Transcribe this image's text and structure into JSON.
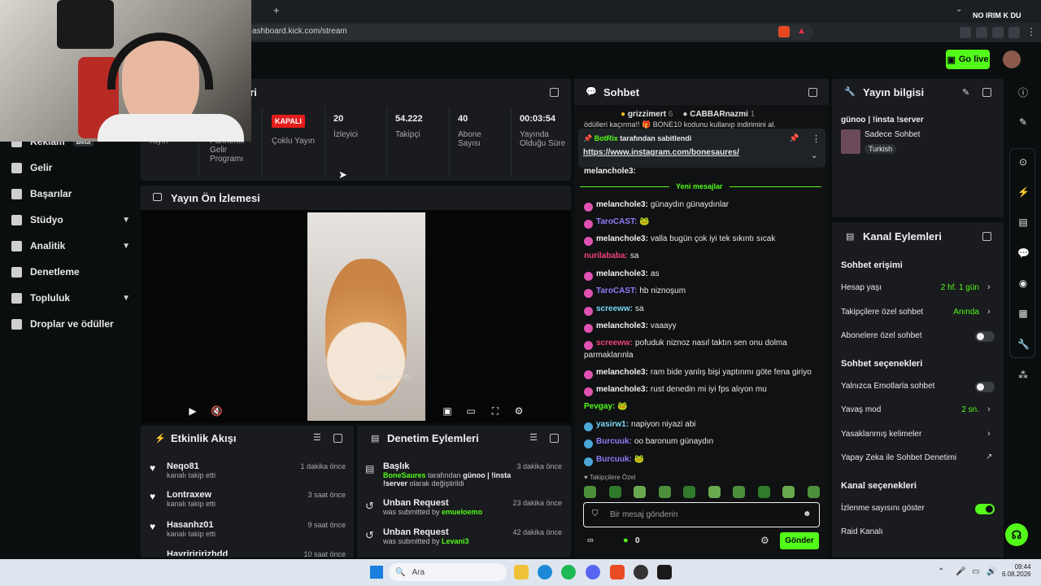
{
  "browser": {
    "url": "ashboard.kick.com/stream",
    "new_tab": "+",
    "profile_text": "NO IRIM K DU"
  },
  "topbar": {
    "go_live": "Go live"
  },
  "sidebar": {
    "items": [
      {
        "label": "Reklam",
        "badge": "Beta"
      },
      {
        "label": "Gelir"
      },
      {
        "label": "Başarılar"
      },
      {
        "label": "Stüdyo",
        "chevron": true
      },
      {
        "label": "Analitik",
        "chevron": true
      },
      {
        "label": "Denetleme"
      },
      {
        "label": "Topluluk",
        "chevron": true
      },
      {
        "label": "Droplar ve ödüller"
      }
    ]
  },
  "stats_panel": {
    "title_fragment": "eri",
    "cells": [
      {
        "value": "",
        "label": "Yayın"
      },
      {
        "value": "",
        "label": "Partnerlik Gelir Programı"
      },
      {
        "value": "KAPALI",
        "label": "Çoklu Yayın"
      },
      {
        "value": "20",
        "label": "İzleyici"
      },
      {
        "value": "54.222",
        "label": "Takipçi"
      },
      {
        "value": "40",
        "label": "Abone Sayısı"
      },
      {
        "value": "00:03:54",
        "label": "Yayında Olduğu Süre"
      }
    ]
  },
  "preview": {
    "title": "Yayın Ön İzlemesi",
    "watermark": "@yourmunch"
  },
  "activity": {
    "title": "Etkinlik Akışı",
    "items": [
      {
        "name": "Neqo81",
        "desc": "kanalı takip etti",
        "time": "1 dakika önce"
      },
      {
        "name": "Lontraxew",
        "desc": "kanalı takip etti",
        "time": "3 saat önce"
      },
      {
        "name": "Hasanhz01",
        "desc": "kanalı takip etti",
        "time": "9 saat önce"
      },
      {
        "name": "Hayririririzhdd",
        "desc": "",
        "time": "10 saat önce"
      }
    ]
  },
  "moderation": {
    "title": "Denetim Eylemleri",
    "items": [
      {
        "title": "Başlık",
        "user": "BoneSaures",
        "mid": "tarafından",
        "subject": "günoo | !insta !server",
        "tail": "olarak değiştirildi",
        "time": "3 dakika önce"
      },
      {
        "title": "Unban Request",
        "prefix": "was submitted by",
        "user": "emueloemo",
        "time": "23 dakika önce"
      },
      {
        "title": "Unban Request",
        "prefix": "was submitted by",
        "user": "Levani3",
        "time": "42 dakika önce"
      }
    ]
  },
  "chat": {
    "title": "Sohbet",
    "gifters": [
      {
        "name": "grizzimert",
        "count": "6"
      },
      {
        "name": "CABBARnazmi",
        "count": "1"
      }
    ],
    "cut_top": "ödülleri kaçırma!! 🎁 BONE10 kodunu kullanıp indirimini al.",
    "pinned": {
      "user": "BotRix",
      "text": "tarafından sabitlendi",
      "link": "https://www.instagram.com/bonesaures/"
    },
    "cut_user": "melanchole3:",
    "new_messages": "Yeni mesajlar",
    "messages": [
      {
        "badge": "26",
        "user": "melanchole3:",
        "color": "#f0f0f0",
        "text": "günaydın günaydınlar"
      },
      {
        "badge": "27",
        "user": "TaroCAST:",
        "color": "#8f7cf7",
        "text": "🐸"
      },
      {
        "badge": "26",
        "user": "melanchole3:",
        "color": "#f0f0f0",
        "text": "valla bugün çok iyi tek sıkıntı sıcak"
      },
      {
        "badge": "",
        "user": "nurilababa:",
        "color": "#f2427a",
        "text": "sa"
      },
      {
        "badge": "26",
        "user": "melanchole3:",
        "color": "#f0f0f0",
        "text": "as"
      },
      {
        "badge": "27",
        "user": "TaroCAST:",
        "color": "#8f7cf7",
        "text": "hb niznoşum"
      },
      {
        "badge": "27",
        "user": "screeww:",
        "color": "#7ad8f5",
        "text": "sa"
      },
      {
        "badge": "26",
        "user": "melanchole3:",
        "color": "#f0f0f0",
        "text": "vaaayy"
      },
      {
        "badge": "27",
        "user": "screeww:",
        "color": "#f2427a",
        "text": "pofuduk niznoz nasıl taktın sen onu dolma parmaklarınla"
      },
      {
        "badge": "26",
        "user": "melanchole3:",
        "color": "#f0f0f0",
        "text": "ram bide yanlış bişi yaptınmı göte fena giriyo"
      },
      {
        "badge": "26",
        "user": "melanchole3:",
        "color": "#f0f0f0",
        "text": "rust denedin mi iyi fps alıyon mu"
      },
      {
        "badge": "",
        "user": "Pevgay:",
        "color": "#53fc18",
        "text": "🐸"
      },
      {
        "badge": "30",
        "user": "yasirw1:",
        "color": "#7ad8f5",
        "text": "napiyon niyazi abi"
      },
      {
        "badge": "31",
        "user": "Burcuuk:",
        "color": "#8f7cf7",
        "text": "oo baronum günaydın"
      },
      {
        "badge": "31",
        "user": "Burcuuk:",
        "color": "#8f7cf7",
        "text": "🐸"
      }
    ],
    "emote_section": "Takipçilere Özel",
    "input_placeholder": "Bir mesaj gönderin",
    "points": "0",
    "send": "Gönder"
  },
  "stream_info": {
    "title": "Yayın bilgisi",
    "stream_title": "günoo | !insta !server",
    "category": "Sadece Sohbet",
    "tag": "Turkish"
  },
  "channel_actions": {
    "title": "Kanal Eylemleri",
    "sections": [
      {
        "heading": "Sohbet erişimi"
      },
      {
        "heading": "Sohbet seçenekleri"
      },
      {
        "heading": "Kanal seçenekleri"
      }
    ],
    "rows": {
      "hesap_yasi": {
        "label": "Hesap yaşı",
        "value": "2 hf. 1 gün"
      },
      "takipci": {
        "label": "Takipçilere özel sohbet",
        "value": "Anında"
      },
      "abone": {
        "label": "Abonelere özel sohbet",
        "on": false
      },
      "emote": {
        "label": "Yalnızca Emotlarla sohbet",
        "on": false
      },
      "yavas": {
        "label": "Yavaş mod",
        "value": "2 sn."
      },
      "yasak": {
        "label": "Yasaklanmış kelimeler"
      },
      "ai": {
        "label": "Yapay Zeka ile Sohbet Denetimi"
      },
      "izlenme": {
        "label": "İzlenme sayısını göster",
        "on": true
      },
      "raid": {
        "label": "Raid Kanalı"
      }
    }
  },
  "taskbar": {
    "search": "Ara",
    "time": "09:44",
    "date": "6.08.2026"
  },
  "colors": {
    "accent": "#53fc18",
    "panel": "#191b1f",
    "bg": "#0b0e0f",
    "live_red": "#e41c1c"
  }
}
